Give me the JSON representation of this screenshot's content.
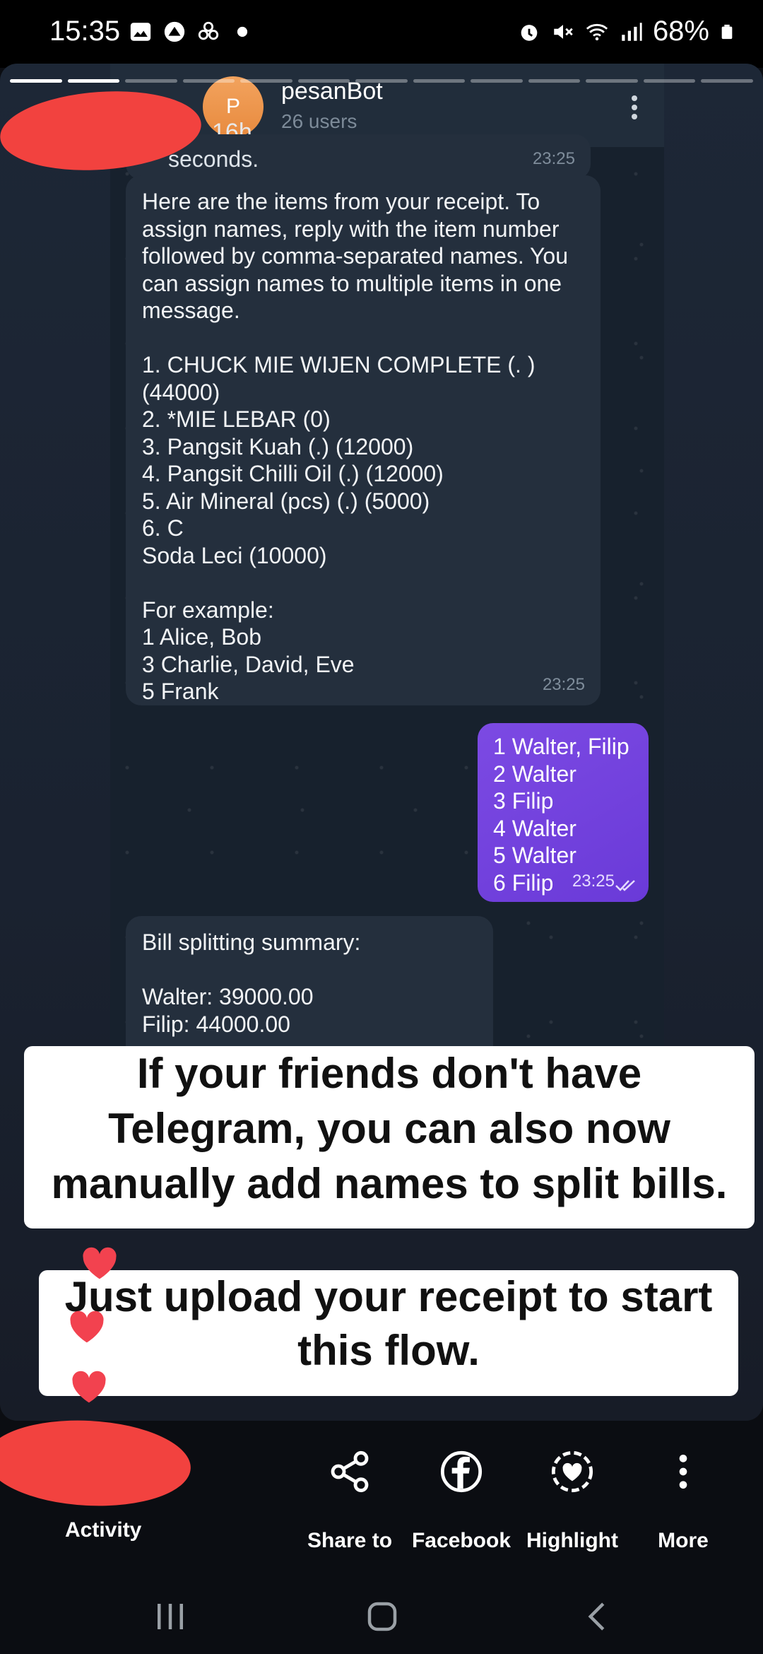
{
  "status_bar": {
    "time": "15:35",
    "battery": "68%"
  },
  "chat": {
    "title": "pesanBot",
    "subtitle": "26 users",
    "avatar_letter": "P",
    "story_age": "16h",
    "partial_top_text": "seconds.",
    "partial_top_time": "23:25",
    "bot_message": {
      "lines": [
        "Here are the items from your receipt. To",
        "assign names, reply with the item number",
        "followed by comma-separated names. You",
        "can assign names to multiple items in one",
        "message.",
        "",
        "1. CHUCK MIE WIJEN COMPLETE (. )",
        "(44000)",
        "2. *MIE LEBAR (0)",
        "3. Pangsit Kuah (.) (12000)",
        "4. Pangsit Chilli Oil (.) (12000)",
        "5. Air Mineral (pcs) (.) (5000)",
        "6. C",
        "Soda Leci (10000)",
        "",
        "For example:",
        "1 Alice, Bob",
        "3 Charlie, David, Eve",
        "5 Frank"
      ],
      "time": "23:25"
    },
    "user_message": {
      "lines": [
        "1 Walter, Filip",
        "2 Walter",
        "3 Filip",
        "4 Walter",
        "5 Walter",
        "6 Filip"
      ],
      "time": "23:25"
    },
    "summary_message": {
      "lines": [
        "Bill splitting summary:",
        "",
        "Walter: 39000.00",
        "Filip: 44000.00"
      ]
    }
  },
  "captions": {
    "first": [
      "If your friends don't have",
      "Telegram, you can also now",
      "manually add names to split bills."
    ],
    "second": [
      "Just upload your receipt to start",
      "this flow."
    ]
  },
  "actions": {
    "activity": "Activity",
    "share": "Share to",
    "facebook": "Facebook",
    "highlight": "Highlight",
    "more": "More"
  },
  "colors": {
    "bubble_out": "#7c4ae3",
    "bubble_in": "#242f3d",
    "heart": "#f2424f",
    "redact": "#f2423f"
  }
}
